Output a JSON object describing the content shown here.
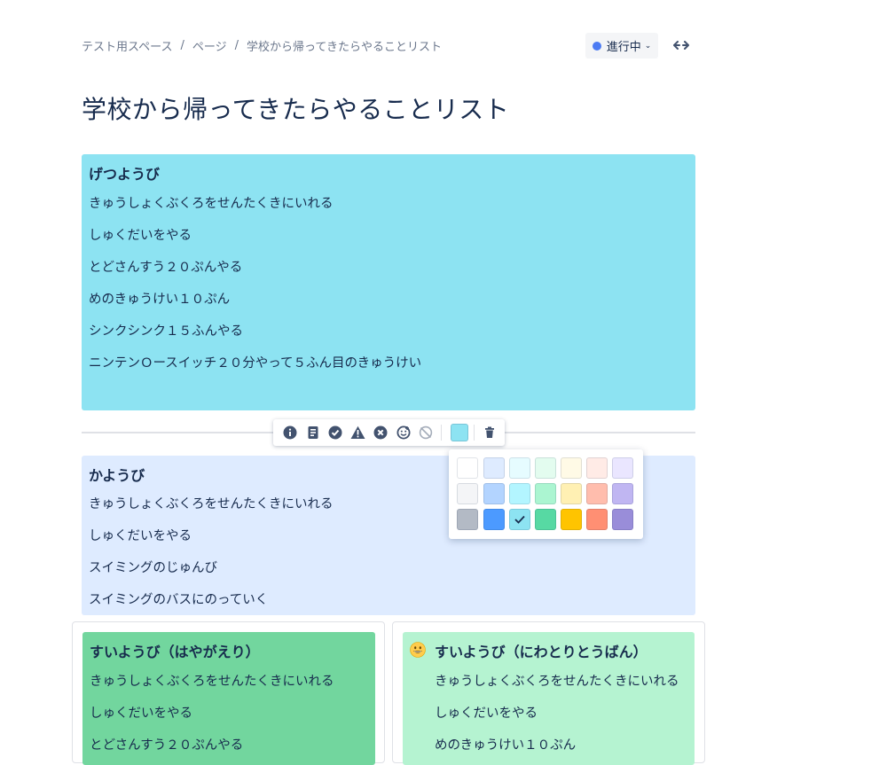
{
  "breadcrumb": {
    "items": [
      "テスト用スペース",
      "ページ",
      "学校から帰ってきたらやることリスト"
    ],
    "separator": "/"
  },
  "status": {
    "label": "進行中",
    "dot_color": "#4c7bf3"
  },
  "page": {
    "title": "学校から帰ってきたらやることリスト"
  },
  "panels": {
    "monday": {
      "title": "げつようび",
      "lines": [
        " きゅうしょくぶくろをせんたくきにいれる",
        "しゅくだいをやる",
        "とどさんすう２０ぷんやる",
        "めのきゅうけい１０ぷん",
        "シンクシンク１５ふんやる",
        "ニンテンＯースイッチ２０分やって５ふん目のきゅうけい"
      ],
      "color": "#8de3f2"
    },
    "tuesday": {
      "title": "かようび",
      "lines": [
        "きゅうしょくぶくろをせんたくきにいれる",
        "しゅくだいをやる",
        "スイミングのじゅんび",
        "スイミングのバスにのっていく"
      ],
      "color": "#deebff"
    },
    "wednesday_early": {
      "title": "すいようび（はやがえり）",
      "lines": [
        "きゅうしょくぶくろをせんたくきにいれる",
        "しゅくだいをやる",
        "とどさんすう２０ぷんやる"
      ],
      "color": "#72d69e"
    },
    "wednesday_chicken": {
      "title": "すいようび（にわとりとうばん）",
      "lines": [
        "きゅうしょくぶくろをせんたくきにいれる",
        "しゅくだいをやる",
        "めのきゅうけい１０ぷん"
      ],
      "color": "#b5f3d1"
    }
  },
  "toolbar": {
    "icons": [
      "info-icon",
      "note-icon",
      "success-icon",
      "warning-icon",
      "error-icon",
      "emoji-icon",
      "no-emoji-icon"
    ],
    "current_color": "#8de3f2",
    "delete_icon": "trash-icon"
  },
  "palette": {
    "rows": [
      [
        "#ffffff",
        "#deebff",
        "#e6fcff",
        "#e3fcef",
        "#fffae6",
        "#ffebe6",
        "#eae6ff"
      ],
      [
        "#f4f5f7",
        "#b3d4ff",
        "#b3f5ff",
        "#abf5d1",
        "#fff0b3",
        "#ffbdad",
        "#c0b6f2"
      ],
      [
        "#b3bac5",
        "#4c9aff",
        "#8de3f2",
        "#57d9a3",
        "#ffc400",
        "#ff8f73",
        "#998dd9"
      ]
    ],
    "selected": "#8de3f2"
  }
}
